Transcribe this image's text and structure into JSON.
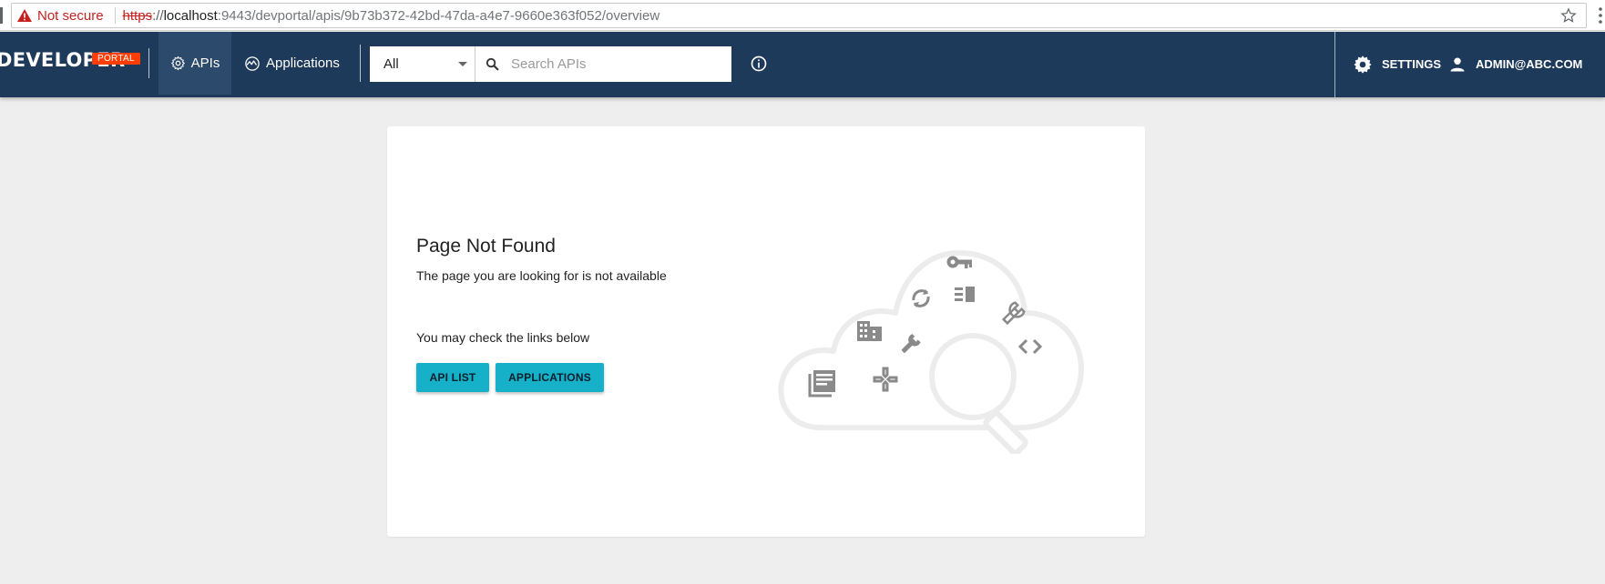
{
  "browser": {
    "security_label": "Not secure",
    "url_scheme": "https",
    "url_sep": "://",
    "url_host": "localhost",
    "url_rest": ":9443/devportal/apis/9b73b372-42bd-47da-a4e7-9660e363f052/overview"
  },
  "header": {
    "brand": "DEVELOPER",
    "brand_badge": "PORTAL",
    "nav": {
      "apis": "APIs",
      "applications": "Applications"
    },
    "search": {
      "select_value": "All",
      "placeholder": "Search APIs"
    },
    "settings": "SETTINGS",
    "user": "ADMIN@ABC.COM"
  },
  "main": {
    "title": "Page Not Found",
    "message": "The page you are looking for is not available",
    "hint": "You may check the links below",
    "buttons": {
      "api_list": "API LIST",
      "applications": "APPLICATIONS"
    }
  },
  "colors": {
    "header_bg": "#1e3a5a",
    "active_nav_bg": "#2c4a6c",
    "badge": "#ff3d00",
    "button": "#17b0c9",
    "page_bg": "#eeeeee"
  },
  "icons": [
    "warning-icon",
    "star-icon",
    "gear-icon",
    "activity-icon",
    "search-icon",
    "info-icon",
    "settings-icon",
    "person-icon",
    "library-icon",
    "building-icon",
    "gamepad-icon",
    "wrench-icon",
    "sync-icon",
    "key-icon",
    "list-icon",
    "build-icon",
    "code-icon",
    "magnifier-icon",
    "cloud-icon"
  ]
}
